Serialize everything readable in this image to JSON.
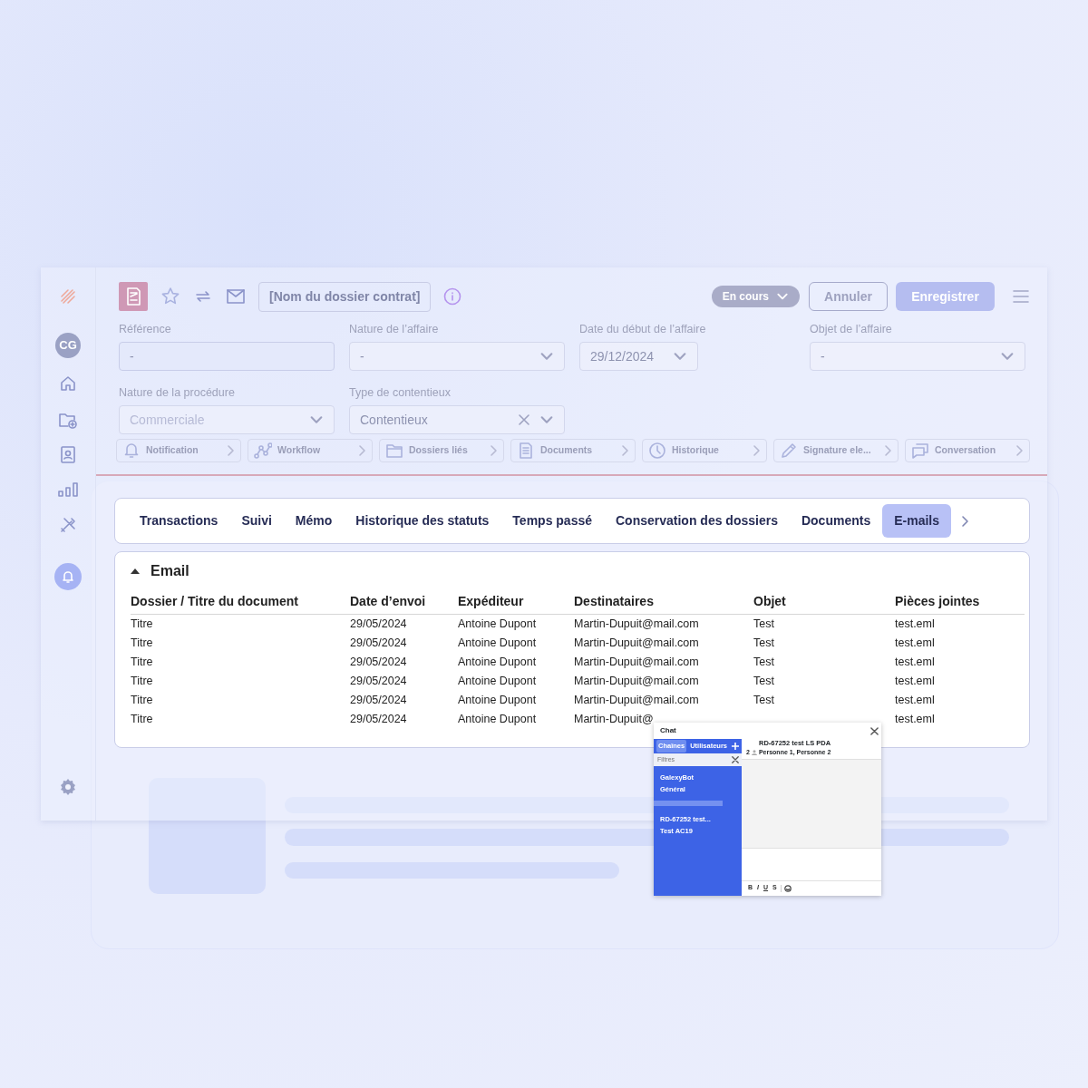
{
  "sidebar": {
    "avatar": "CG"
  },
  "header": {
    "title": "[Nom du dossier contrat]",
    "status": "En cours",
    "cancel": "Annuler",
    "save": "Enregistrer"
  },
  "fields": [
    {
      "label": "Référence",
      "value": "-",
      "kind": "text",
      "disabled": false
    },
    {
      "label": "Nature de l’affaire",
      "value": "-",
      "kind": "select",
      "disabled": false
    },
    {
      "label": "Date du début de l’affaire",
      "value": "29/12/2024",
      "kind": "date",
      "disabled": false
    },
    {
      "label": "Objet de l’affaire",
      "value": "-",
      "kind": "select",
      "disabled": false
    },
    {
      "label": "Nature de la procédure",
      "value": "Commerciale",
      "kind": "select",
      "disabled": true
    },
    {
      "label": "Type de contentieux",
      "value": "Contentieux",
      "kind": "clearable",
      "disabled": false
    }
  ],
  "shortcuts": [
    {
      "label": "Notification",
      "kind": "bell"
    },
    {
      "label": "Workflow",
      "kind": "workflow"
    },
    {
      "label": "Dossiers liés",
      "kind": "folder"
    },
    {
      "label": "Documents",
      "kind": "document"
    },
    {
      "label": "Historique",
      "kind": "clock"
    },
    {
      "label": "Signature ele...",
      "kind": "pencil"
    },
    {
      "label": "Conversation",
      "kind": "chat"
    }
  ],
  "tabs": [
    {
      "label": "Transactions",
      "selected": false
    },
    {
      "label": "Suivi",
      "selected": false
    },
    {
      "label": "Mémo",
      "selected": false
    },
    {
      "label": "Historique des statuts",
      "selected": false
    },
    {
      "label": "Temps passé",
      "selected": false
    },
    {
      "label": "Conservation des dossiers",
      "selected": false
    },
    {
      "label": "Documents",
      "selected": false
    },
    {
      "label": "E-mails",
      "selected": true
    }
  ],
  "email": {
    "title": "Email",
    "expanded": true,
    "columns": [
      "Dossier / Titre du document",
      "Date d’envoi",
      "Expéditeur",
      "Destinataires",
      "Objet",
      "Pièces jointes"
    ],
    "rows": [
      {
        "dossier": "Titre",
        "date": "29/05/2024",
        "expediteur": "Antoine Dupont",
        "destinataires": "Martin-Dupuit@mail.com",
        "objet": "Test",
        "pieces": "test.eml"
      },
      {
        "dossier": "Titre",
        "date": "29/05/2024",
        "expediteur": "Antoine Dupont",
        "destinataires": "Martin-Dupuit@mail.com",
        "objet": "Test",
        "pieces": "test.eml"
      },
      {
        "dossier": "Titre",
        "date": "29/05/2024",
        "expediteur": "Antoine Dupont",
        "destinataires": "Martin-Dupuit@mail.com",
        "objet": "Test",
        "pieces": "test.eml"
      },
      {
        "dossier": "Titre",
        "date": "29/05/2024",
        "expediteur": "Antoine Dupont",
        "destinataires": "Martin-Dupuit@mail.com",
        "objet": "Test",
        "pieces": "test.eml"
      },
      {
        "dossier": "Titre",
        "date": "29/05/2024",
        "expediteur": "Antoine Dupont",
        "destinataires": "Martin-Dupuit@mail.com",
        "objet": "Test",
        "pieces": "test.eml"
      },
      {
        "dossier": "Titre",
        "date": "29/05/2024",
        "expediteur": "Antoine Dupont",
        "destinataires": "Martin-Dupuit@",
        "pieces": "test.eml"
      }
    ]
  },
  "chat": {
    "title": "Chat",
    "tabs": [
      {
        "label": "Chaînes",
        "selected": true
      },
      {
        "label": "Utilisateurs",
        "selected": false
      }
    ],
    "filter_placeholder": "Filtres",
    "channel_groups": [
      [
        "GalexyBot",
        "Général"
      ],
      [
        "RD-67252 test...",
        "Test AC19"
      ]
    ],
    "conversation": {
      "title": "RD-67252 test LS PDA",
      "member_count": "2",
      "members": "Personne 1, Personne 2"
    },
    "toolbar": [
      "B",
      "I",
      "U",
      "S"
    ]
  }
}
